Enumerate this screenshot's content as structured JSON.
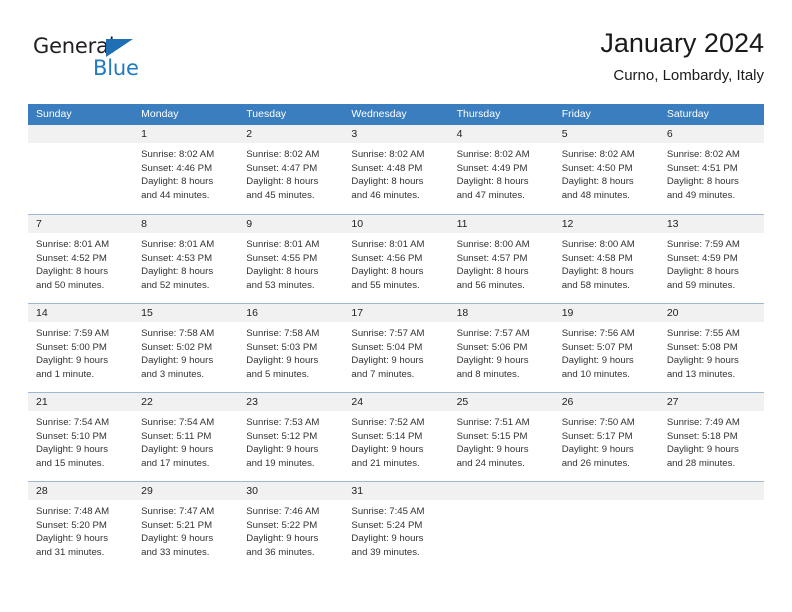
{
  "logo": {
    "word_one": "General",
    "word_two": "Blue",
    "triangle_icon": "blue-triangle-icon",
    "colors": {
      "dark": "#231f20",
      "blue": "#1f7ac0",
      "triangle": "#1f6fb4"
    }
  },
  "header": {
    "title": "January 2024",
    "subtitle": "Curno, Lombardy, Italy"
  },
  "theme": {
    "header_bg": "#3b7ebf",
    "header_text": "#ffffff",
    "day_band_bg": "#f1f1f1",
    "row_divider": "#9fb8cf",
    "body_text": "#333333"
  },
  "weekdays": [
    "Sunday",
    "Monday",
    "Tuesday",
    "Wednesday",
    "Thursday",
    "Friday",
    "Saturday"
  ],
  "weeks": [
    [
      {
        "day": "",
        "lines": []
      },
      {
        "day": "1",
        "lines": [
          "Sunrise: 8:02 AM",
          "Sunset: 4:46 PM",
          "Daylight: 8 hours",
          "and 44 minutes."
        ]
      },
      {
        "day": "2",
        "lines": [
          "Sunrise: 8:02 AM",
          "Sunset: 4:47 PM",
          "Daylight: 8 hours",
          "and 45 minutes."
        ]
      },
      {
        "day": "3",
        "lines": [
          "Sunrise: 8:02 AM",
          "Sunset: 4:48 PM",
          "Daylight: 8 hours",
          "and 46 minutes."
        ]
      },
      {
        "day": "4",
        "lines": [
          "Sunrise: 8:02 AM",
          "Sunset: 4:49 PM",
          "Daylight: 8 hours",
          "and 47 minutes."
        ]
      },
      {
        "day": "5",
        "lines": [
          "Sunrise: 8:02 AM",
          "Sunset: 4:50 PM",
          "Daylight: 8 hours",
          "and 48 minutes."
        ]
      },
      {
        "day": "6",
        "lines": [
          "Sunrise: 8:02 AM",
          "Sunset: 4:51 PM",
          "Daylight: 8 hours",
          "and 49 minutes."
        ]
      }
    ],
    [
      {
        "day": "7",
        "lines": [
          "Sunrise: 8:01 AM",
          "Sunset: 4:52 PM",
          "Daylight: 8 hours",
          "and 50 minutes."
        ]
      },
      {
        "day": "8",
        "lines": [
          "Sunrise: 8:01 AM",
          "Sunset: 4:53 PM",
          "Daylight: 8 hours",
          "and 52 minutes."
        ]
      },
      {
        "day": "9",
        "lines": [
          "Sunrise: 8:01 AM",
          "Sunset: 4:55 PM",
          "Daylight: 8 hours",
          "and 53 minutes."
        ]
      },
      {
        "day": "10",
        "lines": [
          "Sunrise: 8:01 AM",
          "Sunset: 4:56 PM",
          "Daylight: 8 hours",
          "and 55 minutes."
        ]
      },
      {
        "day": "11",
        "lines": [
          "Sunrise: 8:00 AM",
          "Sunset: 4:57 PM",
          "Daylight: 8 hours",
          "and 56 minutes."
        ]
      },
      {
        "day": "12",
        "lines": [
          "Sunrise: 8:00 AM",
          "Sunset: 4:58 PM",
          "Daylight: 8 hours",
          "and 58 minutes."
        ]
      },
      {
        "day": "13",
        "lines": [
          "Sunrise: 7:59 AM",
          "Sunset: 4:59 PM",
          "Daylight: 8 hours",
          "and 59 minutes."
        ]
      }
    ],
    [
      {
        "day": "14",
        "lines": [
          "Sunrise: 7:59 AM",
          "Sunset: 5:00 PM",
          "Daylight: 9 hours",
          "and 1 minute."
        ]
      },
      {
        "day": "15",
        "lines": [
          "Sunrise: 7:58 AM",
          "Sunset: 5:02 PM",
          "Daylight: 9 hours",
          "and 3 minutes."
        ]
      },
      {
        "day": "16",
        "lines": [
          "Sunrise: 7:58 AM",
          "Sunset: 5:03 PM",
          "Daylight: 9 hours",
          "and 5 minutes."
        ]
      },
      {
        "day": "17",
        "lines": [
          "Sunrise: 7:57 AM",
          "Sunset: 5:04 PM",
          "Daylight: 9 hours",
          "and 7 minutes."
        ]
      },
      {
        "day": "18",
        "lines": [
          "Sunrise: 7:57 AM",
          "Sunset: 5:06 PM",
          "Daylight: 9 hours",
          "and 8 minutes."
        ]
      },
      {
        "day": "19",
        "lines": [
          "Sunrise: 7:56 AM",
          "Sunset: 5:07 PM",
          "Daylight: 9 hours",
          "and 10 minutes."
        ]
      },
      {
        "day": "20",
        "lines": [
          "Sunrise: 7:55 AM",
          "Sunset: 5:08 PM",
          "Daylight: 9 hours",
          "and 13 minutes."
        ]
      }
    ],
    [
      {
        "day": "21",
        "lines": [
          "Sunrise: 7:54 AM",
          "Sunset: 5:10 PM",
          "Daylight: 9 hours",
          "and 15 minutes."
        ]
      },
      {
        "day": "22",
        "lines": [
          "Sunrise: 7:54 AM",
          "Sunset: 5:11 PM",
          "Daylight: 9 hours",
          "and 17 minutes."
        ]
      },
      {
        "day": "23",
        "lines": [
          "Sunrise: 7:53 AM",
          "Sunset: 5:12 PM",
          "Daylight: 9 hours",
          "and 19 minutes."
        ]
      },
      {
        "day": "24",
        "lines": [
          "Sunrise: 7:52 AM",
          "Sunset: 5:14 PM",
          "Daylight: 9 hours",
          "and 21 minutes."
        ]
      },
      {
        "day": "25",
        "lines": [
          "Sunrise: 7:51 AM",
          "Sunset: 5:15 PM",
          "Daylight: 9 hours",
          "and 24 minutes."
        ]
      },
      {
        "day": "26",
        "lines": [
          "Sunrise: 7:50 AM",
          "Sunset: 5:17 PM",
          "Daylight: 9 hours",
          "and 26 minutes."
        ]
      },
      {
        "day": "27",
        "lines": [
          "Sunrise: 7:49 AM",
          "Sunset: 5:18 PM",
          "Daylight: 9 hours",
          "and 28 minutes."
        ]
      }
    ],
    [
      {
        "day": "28",
        "lines": [
          "Sunrise: 7:48 AM",
          "Sunset: 5:20 PM",
          "Daylight: 9 hours",
          "and 31 minutes."
        ]
      },
      {
        "day": "29",
        "lines": [
          "Sunrise: 7:47 AM",
          "Sunset: 5:21 PM",
          "Daylight: 9 hours",
          "and 33 minutes."
        ]
      },
      {
        "day": "30",
        "lines": [
          "Sunrise: 7:46 AM",
          "Sunset: 5:22 PM",
          "Daylight: 9 hours",
          "and 36 minutes."
        ]
      },
      {
        "day": "31",
        "lines": [
          "Sunrise: 7:45 AM",
          "Sunset: 5:24 PM",
          "Daylight: 9 hours",
          "and 39 minutes."
        ]
      },
      {
        "day": "",
        "lines": []
      },
      {
        "day": "",
        "lines": []
      },
      {
        "day": "",
        "lines": []
      }
    ]
  ]
}
